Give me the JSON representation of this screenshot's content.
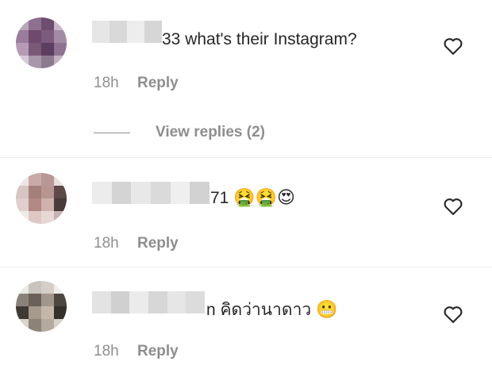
{
  "comments": [
    {
      "visible_text": "33 what's their Instagram?",
      "time": "18h",
      "reply_label": "Reply",
      "view_replies": "View replies (2)"
    },
    {
      "visible_text": "71",
      "emojis": "🤮🤮😍",
      "time": "18h",
      "reply_label": "Reply"
    },
    {
      "visible_text": "n คิดว่านาดาว",
      "emojis": "😬",
      "time": "18h",
      "reply_label": "Reply"
    }
  ],
  "icons": {
    "like": "heart-icon"
  },
  "colors": {
    "text": "#262626",
    "secondary": "#8e8e8e"
  }
}
